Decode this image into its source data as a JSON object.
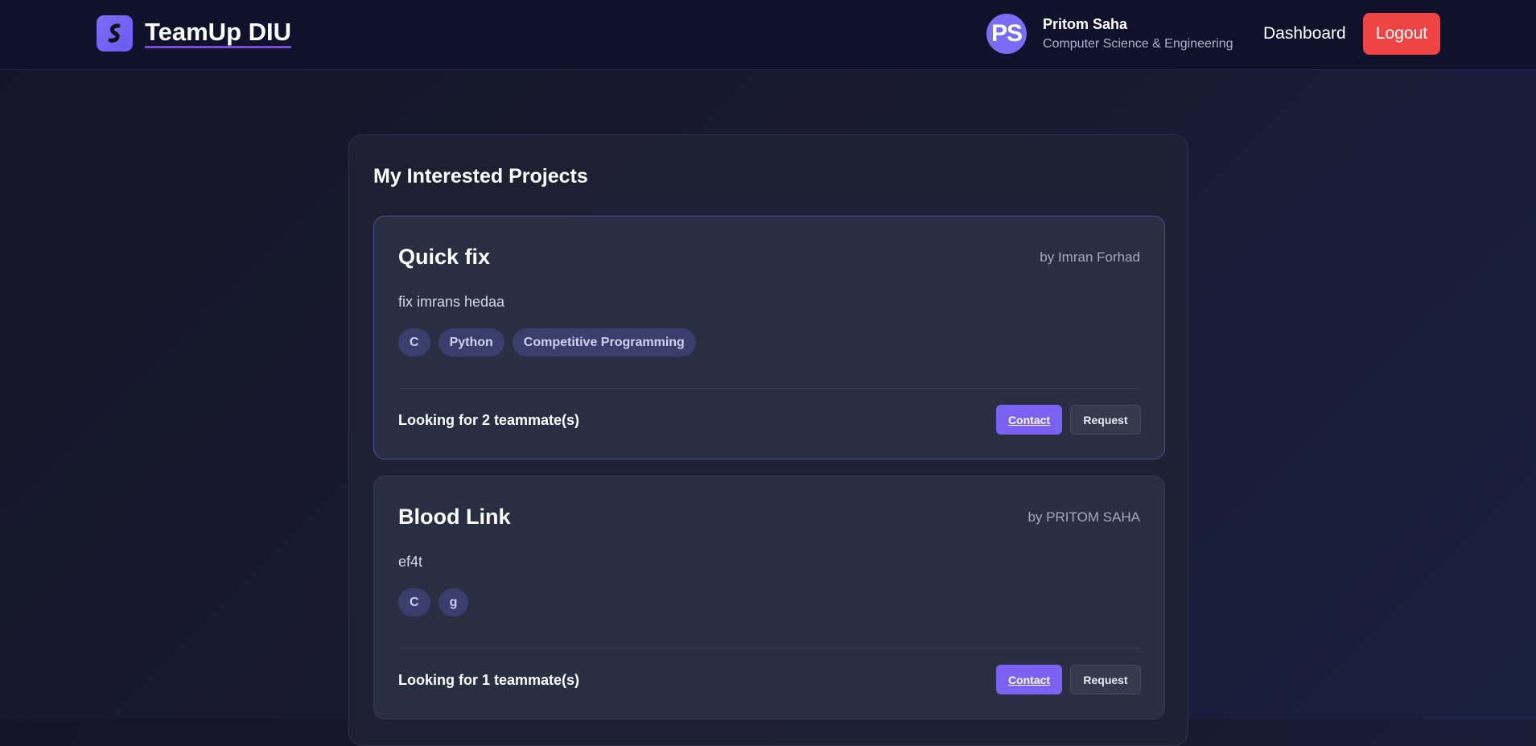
{
  "header": {
    "brand": "TeamUp DIU",
    "logo_icon": "brand-logo-icon",
    "user": {
      "initials": "PS",
      "name": "Pritom Saha",
      "department": "Computer Science & Engineering"
    },
    "nav_dashboard": "Dashboard",
    "logout_label": "Logout"
  },
  "main": {
    "title": "My Interested Projects",
    "projects": [
      {
        "title": "Quick fix",
        "author": "by Imran Forhad",
        "description": "fix imrans hedaa",
        "tags": [
          "C",
          "Python",
          "Competitive Programming"
        ],
        "looking_prefix": "Looking for ",
        "looking_count": "2",
        "looking_suffix": " teammate(s)",
        "contact_label": "Contact",
        "request_label": "Request"
      },
      {
        "title": "Blood Link",
        "author": "by PRITOM SAHA",
        "description": "ef4t",
        "tags": [
          "C",
          "g"
        ],
        "looking_prefix": "Looking for ",
        "looking_count": "1",
        "looking_suffix": " teammate(s)",
        "contact_label": "Contact",
        "request_label": "Request"
      }
    ]
  },
  "colors": {
    "accent": "#7b62f2",
    "logout": "#ef4444",
    "background": "#151528"
  }
}
